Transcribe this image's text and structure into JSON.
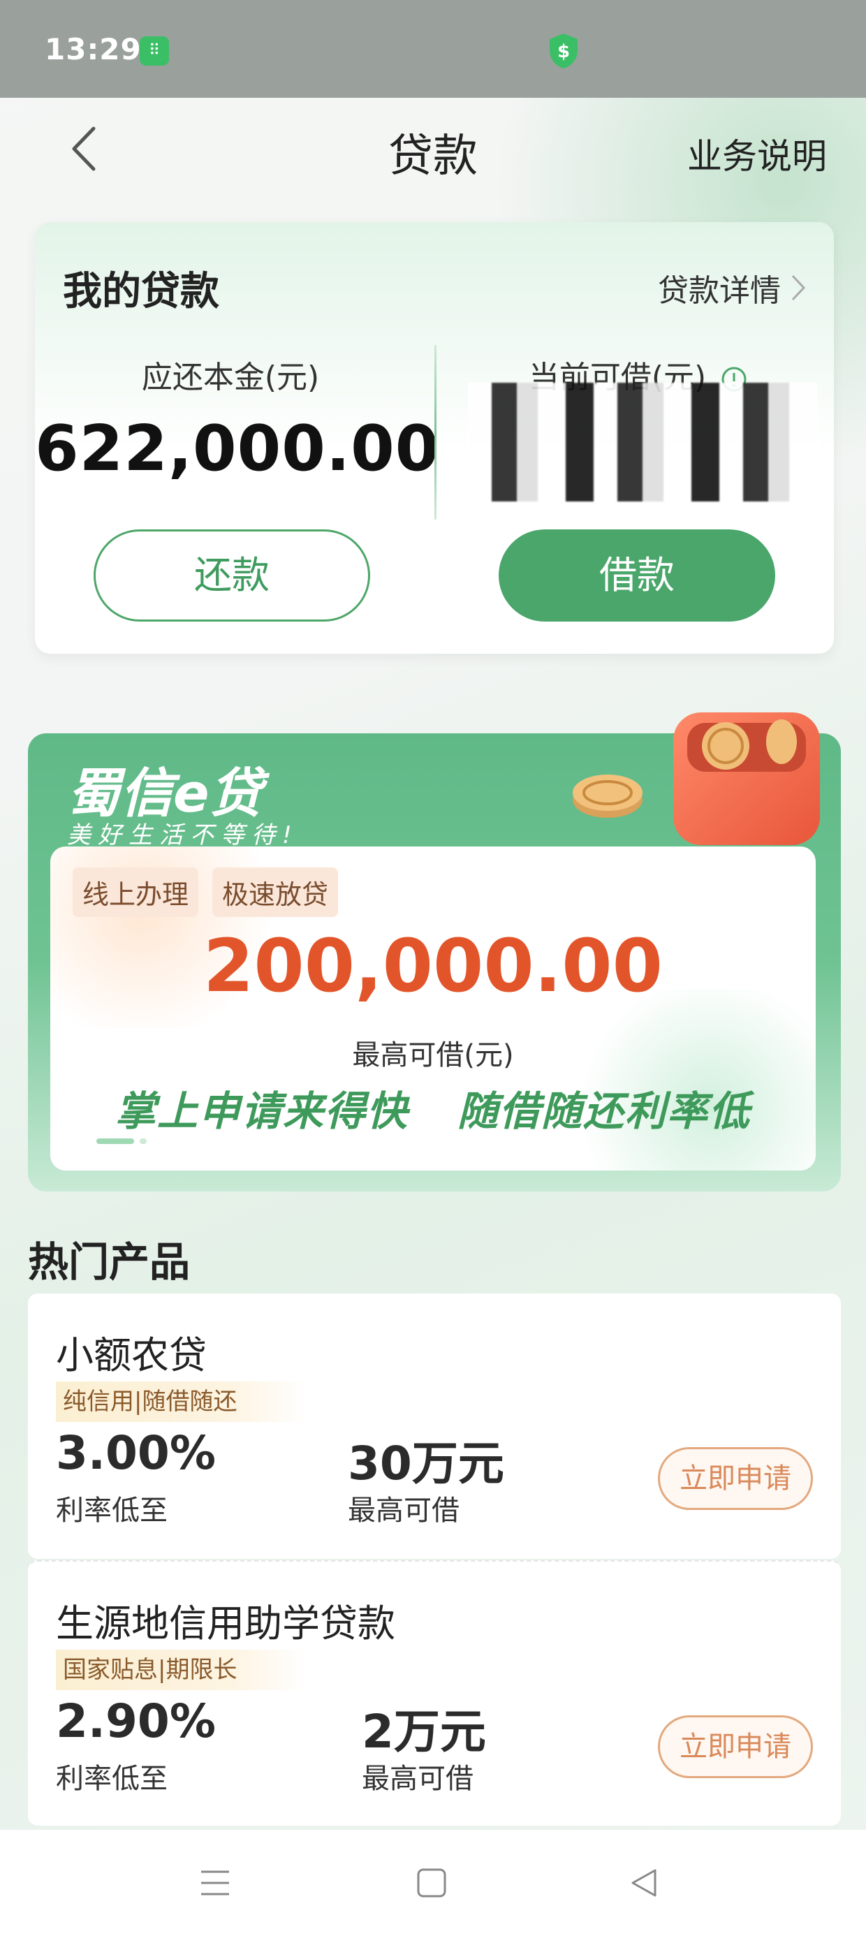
{
  "status_bar": {
    "time": "13:29",
    "app_icon": "app-notification-icon",
    "shield_icon": "dollar-shield-icon"
  },
  "nav": {
    "title": "贷款",
    "help_label": "业务说明"
  },
  "my_loan": {
    "title": "我的贷款",
    "detail_link": "贷款详情",
    "principal_label": "应还本金(元)",
    "principal_value": "622,000.00",
    "available_label": "当前可借(元)",
    "available_value": "",
    "repay_label": "还款",
    "borrow_label": "借款"
  },
  "banner": {
    "brand": "蜀信e贷",
    "slogan": "美好生活不等待!",
    "tags": [
      "线上办理",
      "极速放贷"
    ],
    "amount": "200,000.00",
    "amount_label": "最高可借(元)",
    "features": [
      "掌上申请来得快",
      "随借随还利率低"
    ]
  },
  "hot_products": {
    "title": "热门产品",
    "items": [
      {
        "name": "小额农贷",
        "tag": "纯信用|随借随还",
        "rate": "3.00%",
        "rate_label": "利率低至",
        "max": "30万元",
        "max_label": "最高可借",
        "apply_label": "立即申请"
      },
      {
        "name": "生源地信用助学贷款",
        "tag": "国家贴息|期限长",
        "rate": "2.90%",
        "rate_label": "利率低至",
        "max": "2万元",
        "max_label": "最高可借",
        "apply_label": "立即申请"
      }
    ]
  },
  "colors": {
    "accent_green": "#4aa66a",
    "amount_orange": "#e2552a",
    "apply_orange": "#d9895a"
  }
}
